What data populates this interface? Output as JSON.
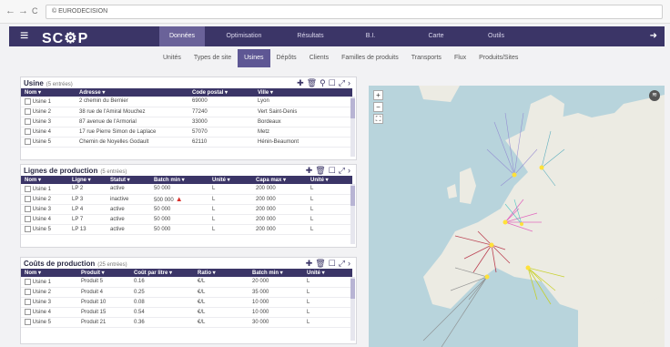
{
  "browser": {
    "back": "←",
    "forward": "→",
    "reload": "C",
    "url": "© EURODECISION"
  },
  "app": {
    "logo": "SC⚙P",
    "main_nav": [
      {
        "label": "Données",
        "active": true
      },
      {
        "label": "Optimisation",
        "active": false
      },
      {
        "label": "Résultats",
        "active": false
      },
      {
        "label": "B.I.",
        "active": false
      },
      {
        "label": "Carte",
        "active": false
      },
      {
        "label": "Outils",
        "active": false
      }
    ],
    "sub_nav": [
      {
        "label": "Unités",
        "active": false
      },
      {
        "label": "Types de site",
        "active": false
      },
      {
        "label": "Usines",
        "active": true
      },
      {
        "label": "Dépôts",
        "active": false
      },
      {
        "label": "Clients",
        "active": false
      },
      {
        "label": "Familles de produits",
        "active": false
      },
      {
        "label": "Transports",
        "active": false
      },
      {
        "label": "Flux",
        "active": false
      },
      {
        "label": "Produits/Sites",
        "active": false
      }
    ]
  },
  "usine": {
    "title": "Usine",
    "count": "(5 entrées)",
    "headers": [
      "Nom",
      "Adresse",
      "Code postal",
      "Ville"
    ],
    "rows": [
      [
        "Usine 1",
        "2 chemin du Bernier",
        "69000",
        "Lyon"
      ],
      [
        "Usine 2",
        "38 rue de l'Amiral Mouchez",
        "77240",
        "Vert Saint-Denis"
      ],
      [
        "Usine 3",
        "87 avenue de l'Armorial",
        "33000",
        "Bordeaux"
      ],
      [
        "Usine 4",
        "17 rue Pierre Simon de Laplace",
        "57070",
        "Metz"
      ],
      [
        "Usine 5",
        "Chemin de Noyelles Godault",
        "62110",
        "Hénin-Beaumont"
      ]
    ]
  },
  "lignes": {
    "title": "Lignes de production",
    "count": "(5 entrées)",
    "headers": [
      "Nom",
      "Ligne",
      "Statut",
      "Batch min",
      "Unité",
      "Capa max",
      "Unité"
    ],
    "rows": [
      [
        "Usine 1",
        "LP 2",
        "active",
        "50 000",
        "L",
        "200 000",
        "L"
      ],
      [
        "Usine 2",
        "LP 3",
        "inactive",
        "500 000",
        "L",
        "200 000",
        "L"
      ],
      [
        "Usine 3",
        "LP 4",
        "active",
        "50 000",
        "L",
        "200 000",
        "L"
      ],
      [
        "Usine 4",
        "LP 7",
        "active",
        "50 000",
        "L",
        "200 000",
        "L"
      ],
      [
        "Usine 5",
        "LP 13",
        "active",
        "50 000",
        "L",
        "200 000",
        "L"
      ]
    ]
  },
  "couts": {
    "title": "Coûts de production",
    "count": "(25 entrées)",
    "headers": [
      "Nom",
      "Produit",
      "Coût par litre",
      "Ratio",
      "Batch min",
      "Unité"
    ],
    "rows": [
      [
        "Usine 1",
        "Produit 5",
        "0.16",
        "€/L",
        "20 000",
        "L"
      ],
      [
        "Usine 2",
        "Produit 4",
        "0.25",
        "€/L",
        "35 000",
        "L"
      ],
      [
        "Usine 3",
        "Produit 10",
        "0.08",
        "€/L",
        "10 000",
        "L"
      ],
      [
        "Usine 4",
        "Produit 15",
        "0.54",
        "€/L",
        "10 000",
        "L"
      ],
      [
        "Usine 5",
        "Produit 21",
        "0.36",
        "€/L",
        "30 000",
        "L"
      ]
    ]
  },
  "colors": {
    "brand": "#3b3567",
    "active_tab": "#6a6299",
    "map_sea": "#b8d4dc",
    "map_land": "#ecebe3"
  }
}
